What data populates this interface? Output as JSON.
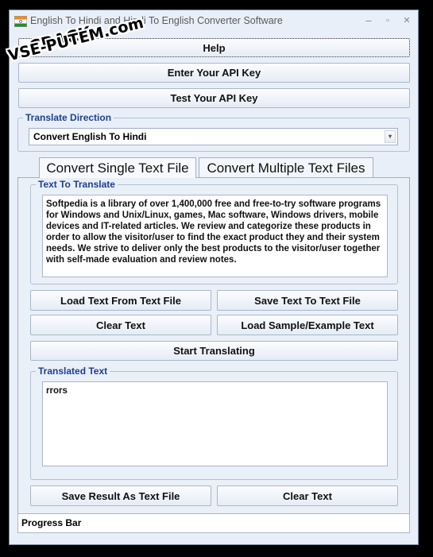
{
  "window": {
    "title": "English To Hindi and Hindi To English Converter Software",
    "min_glyph": "–",
    "max_glyph": "▫",
    "close_glyph": "✕"
  },
  "watermark": {
    "line1": "CRACK",
    "line2": "VSE-PUTEM.com"
  },
  "toolbar": {
    "help_label": "Help",
    "enter_key_label": "Enter Your API Key",
    "test_key_label": "Test Your API Key"
  },
  "direction": {
    "group_label": "Translate Direction",
    "selected": "Convert English To Hindi",
    "arrow": "▾"
  },
  "tabs": [
    {
      "label": "Convert Single Text File"
    },
    {
      "label": "Convert Multiple Text Files"
    }
  ],
  "input": {
    "group_label": "Text To Translate",
    "text": "Softpedia is a library of over 1,400,000 free and free-to-try software programs for Windows and Unix/Linux, games, Mac software, Windows drivers, mobile devices and IT-related articles. We review and categorize these products in order to allow the visitor/user to find the exact product they and their system needs. We strive to deliver only the best products to the visitor/user together with self-made evaluation and review notes."
  },
  "actions": {
    "load_text_label": "Load Text From Text File",
    "save_text_label": "Save Text To Text File",
    "clear_text_label": "Clear Text",
    "load_sample_label": "Load Sample/Example Text",
    "start_label": "Start Translating"
  },
  "output": {
    "group_label": "Translated Text",
    "text": "rrors"
  },
  "result_actions": {
    "save_result_label": "Save Result As Text File",
    "clear_label": "Clear Text"
  },
  "status": {
    "progress_label": "Progress Bar"
  },
  "colors": {
    "accent": "#1f3f8f",
    "window_bg": "#e9eff8"
  }
}
